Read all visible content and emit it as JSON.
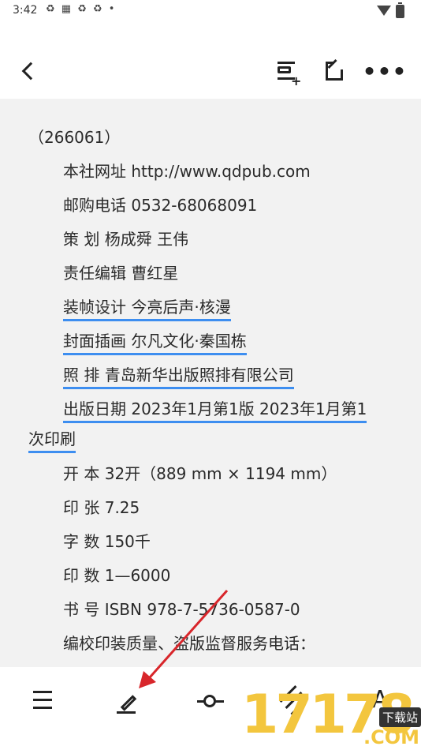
{
  "status_bar": {
    "time": "3:42",
    "notification_icons": "♻ ▦ ♻ ♻ •"
  },
  "toolbar": {
    "more_label": "•••"
  },
  "document_lines": [
    "（266061）",
    "本社网址 http://www.qdpub.com",
    "邮购电话 0532-68068091",
    "策 划 杨成舜 王伟",
    "责任编辑 曹红星",
    "装帧设计 今亮后声·核漫",
    "封面插画 尔凡文化·秦国栋",
    "照 排 青岛新华出版照排有限公司",
    "出版日期  2023年1月第1版  2023年1月第1",
    "次印刷",
    "开 本 32开（889 mm × 1194 mm）",
    "印 张 7.25",
    "字 数 150千",
    "印 数 1—6000",
    "书 号 ISBN 978-7-5736-0587-0",
    "编校印装质量、盗版监督服务电话："
  ],
  "bottom_bar": {
    "font_label": "A"
  },
  "watermark": {
    "number": "17178",
    "download": "下载站",
    "domain": ".COM"
  },
  "colors": {
    "highlight": "#3d8ef0",
    "arrow": "#d8262b",
    "watermark": "#f3c63e"
  }
}
